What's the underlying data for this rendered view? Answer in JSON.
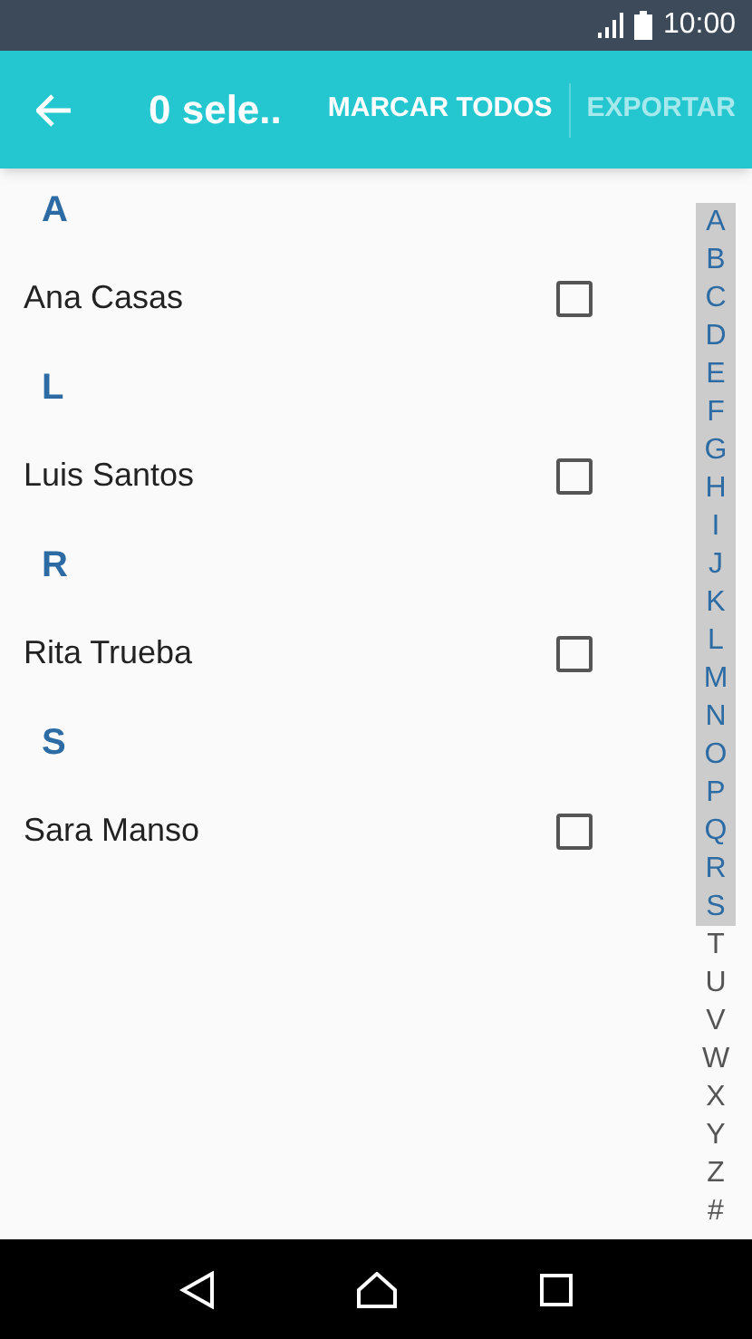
{
  "status_bar": {
    "time": "10:00"
  },
  "toolbar": {
    "title": "0 sele..",
    "actions": [
      {
        "label": "MARCAR TODOS",
        "disabled": false
      },
      {
        "label": "EXPORTAR",
        "disabled": true
      }
    ]
  },
  "sections": [
    {
      "letter": "A",
      "contacts": [
        {
          "name": "Ana Casas",
          "checked": false
        }
      ]
    },
    {
      "letter": "L",
      "contacts": [
        {
          "name": "Luis Santos",
          "checked": false
        }
      ]
    },
    {
      "letter": "R",
      "contacts": [
        {
          "name": "Rita Trueba",
          "checked": false
        }
      ]
    },
    {
      "letter": "S",
      "contacts": [
        {
          "name": "Sara Manso",
          "checked": false
        }
      ]
    }
  ],
  "index": [
    {
      "letter": "A",
      "highlighted": true
    },
    {
      "letter": "B",
      "highlighted": true
    },
    {
      "letter": "C",
      "highlighted": true
    },
    {
      "letter": "D",
      "highlighted": true
    },
    {
      "letter": "E",
      "highlighted": true
    },
    {
      "letter": "F",
      "highlighted": true
    },
    {
      "letter": "G",
      "highlighted": true
    },
    {
      "letter": "H",
      "highlighted": true
    },
    {
      "letter": "I",
      "highlighted": true
    },
    {
      "letter": "J",
      "highlighted": true
    },
    {
      "letter": "K",
      "highlighted": true
    },
    {
      "letter": "L",
      "highlighted": true
    },
    {
      "letter": "M",
      "highlighted": true
    },
    {
      "letter": "N",
      "highlighted": true
    },
    {
      "letter": "O",
      "highlighted": true
    },
    {
      "letter": "P",
      "highlighted": true
    },
    {
      "letter": "Q",
      "highlighted": true
    },
    {
      "letter": "R",
      "highlighted": true
    },
    {
      "letter": "S",
      "highlighted": true
    },
    {
      "letter": "T",
      "highlighted": false
    },
    {
      "letter": "U",
      "highlighted": false
    },
    {
      "letter": "V",
      "highlighted": false
    },
    {
      "letter": "W",
      "highlighted": false
    },
    {
      "letter": "X",
      "highlighted": false
    },
    {
      "letter": "Y",
      "highlighted": false
    },
    {
      "letter": "Z",
      "highlighted": false
    },
    {
      "letter": "#",
      "highlighted": false
    }
  ]
}
